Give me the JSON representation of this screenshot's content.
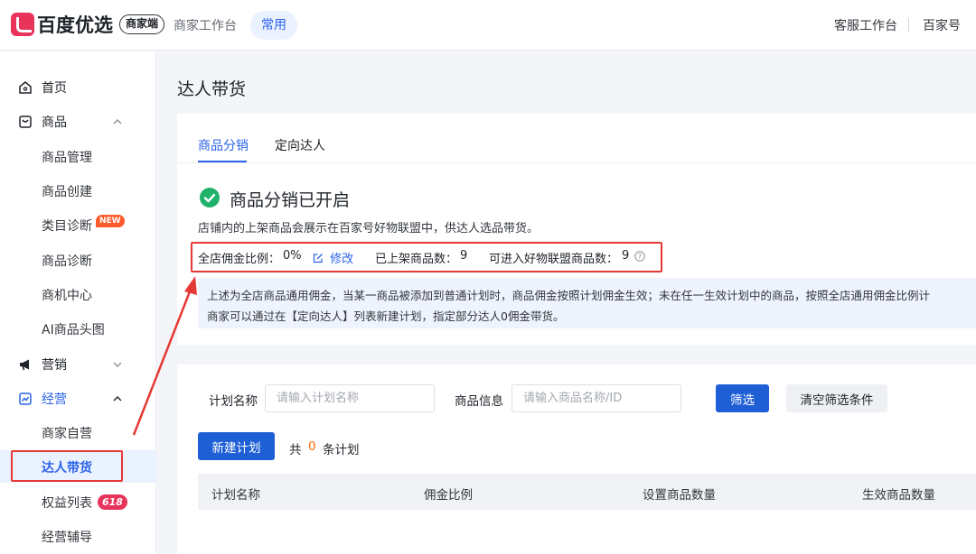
{
  "header": {
    "logo_text": "百度优选",
    "logo_tag": "商家端",
    "workbench": "商家工作台",
    "chip": "常用",
    "right_links": [
      "客服工作台",
      "百家号"
    ]
  },
  "sidebar": {
    "items": [
      {
        "label": "首页",
        "icon": "home-icon"
      },
      {
        "label": "商品",
        "icon": "goods-icon"
      },
      {
        "label": "商品管理"
      },
      {
        "label": "商品创建"
      },
      {
        "label": "类目诊断",
        "badge": "NEW"
      },
      {
        "label": "商品诊断"
      },
      {
        "label": "商机中心"
      },
      {
        "label": "AI商品头图"
      },
      {
        "label": "营销",
        "icon": "megaphone-icon"
      },
      {
        "label": "经营",
        "icon": "chart-icon"
      },
      {
        "label": "商家自营"
      },
      {
        "label": "达人带货"
      },
      {
        "label": "权益列表",
        "badge": "618"
      },
      {
        "label": "经营辅导"
      }
    ]
  },
  "page": {
    "title": "达人带货",
    "tabs": [
      "商品分销",
      "定向达人"
    ],
    "status_title": "商品分销已开启",
    "description": "店铺内的上架商品会展示在百家号好物联盟中，供达人选品带货。",
    "stats": {
      "commission_label": "全店佣金比例：",
      "commission_value": "0%",
      "edit_label": "修改",
      "listed_label": "已上架商品数：",
      "listed_value": "9",
      "alliance_label": "可进入好物联盟商品数：",
      "alliance_value": "9"
    },
    "info_lines": [
      "上述为全店商品通用佣金，当某一商品被添加到普通计划时，商品佣金按照计划佣金生效；未在任一生效计划中的商品，按照全店通用佣金比例计",
      "商家可以通过在【定向达人】列表新建计划，指定部分达人0佣金带货。"
    ]
  },
  "filter": {
    "plan_name_label": "计划名称",
    "plan_name_placeholder": "请输入计划名称",
    "goods_info_label": "商品信息",
    "goods_info_placeholder": "请输入商品名称/ID",
    "filter_button": "筛选",
    "clear_button": "清空筛选条件"
  },
  "plans": {
    "new_button": "新建计划",
    "count_prefix": "共",
    "count_value": "0",
    "count_suffix": "条计划",
    "columns": [
      "计划名称",
      "佣金比例",
      "设置商品数量",
      "生效商品数量"
    ]
  },
  "colors": {
    "accent": "#2a62e8",
    "brand": "#e8335a",
    "annotation": "#e53935",
    "success": "#20b26b"
  }
}
